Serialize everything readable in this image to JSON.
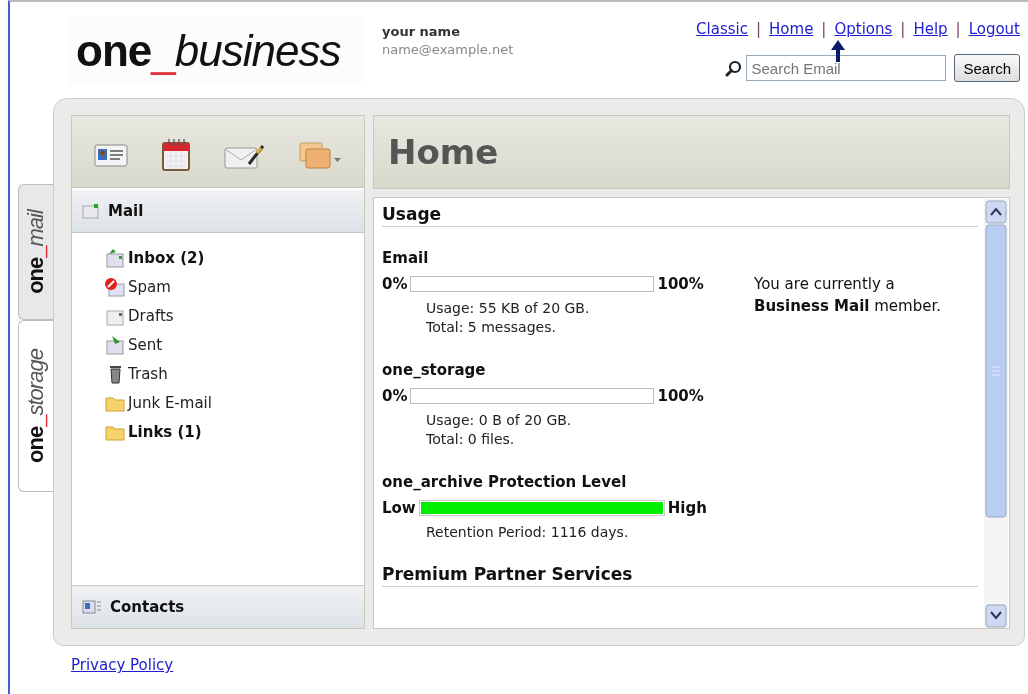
{
  "header": {
    "logo": {
      "brand": "one",
      "separator": "_",
      "product": "business"
    },
    "user_name": "your name",
    "user_email": "name@example.net",
    "links": [
      {
        "label": "Classic"
      },
      {
        "label": "Home"
      },
      {
        "label": "Options"
      },
      {
        "label": "Help"
      },
      {
        "label": "Logout"
      }
    ],
    "link_separator": "|",
    "search": {
      "placeholder": "Search Email",
      "button": "Search"
    }
  },
  "side_tabs": [
    {
      "brand": "one",
      "separator": "_",
      "name": "mail",
      "selected": true
    },
    {
      "brand": "one",
      "separator": "_",
      "name": "storage",
      "selected": false
    }
  ],
  "toolbar": [
    {
      "kind": "contact-card"
    },
    {
      "kind": "calendar"
    },
    {
      "kind": "compose"
    },
    {
      "kind": "folders"
    }
  ],
  "mail_header": "Mail",
  "folders": [
    {
      "kind": "inbox",
      "label": "Inbox (2)",
      "unread": true
    },
    {
      "kind": "spam",
      "label": "Spam",
      "unread": false
    },
    {
      "kind": "drafts",
      "label": "Drafts",
      "unread": false
    },
    {
      "kind": "sent",
      "label": "Sent",
      "unread": false
    },
    {
      "kind": "trash",
      "label": "Trash",
      "unread": false
    },
    {
      "kind": "folder",
      "label": "Junk E-mail",
      "unread": false
    },
    {
      "kind": "folder",
      "label": "Links (1)",
      "unread": true
    }
  ],
  "contacts_header": "Contacts",
  "page_title": "Home",
  "usage": {
    "title": "Usage",
    "meters": [
      {
        "title": "Email",
        "min_label": "0%",
        "max_label": "100%",
        "level": 0,
        "kind": "usage",
        "details": [
          "Usage: 55 KB of 20 GB.",
          "Total: 5 messages."
        ]
      },
      {
        "title": "one_storage",
        "min_label": "0%",
        "max_label": "100%",
        "level": 0,
        "kind": "usage",
        "details": [
          "Usage: 0 B of 20 GB.",
          "Total: 0 files."
        ]
      },
      {
        "title": "one_archive Protection Level",
        "min_label": "Low",
        "max_label": "High",
        "level": 1,
        "kind": "protection",
        "details": [
          "Retention Period: 1116 days."
        ]
      }
    ],
    "membership": "You are currently a **Business Mail** member."
  },
  "next_section": "Premium Partner Services",
  "footer_link": "Privacy Policy"
}
